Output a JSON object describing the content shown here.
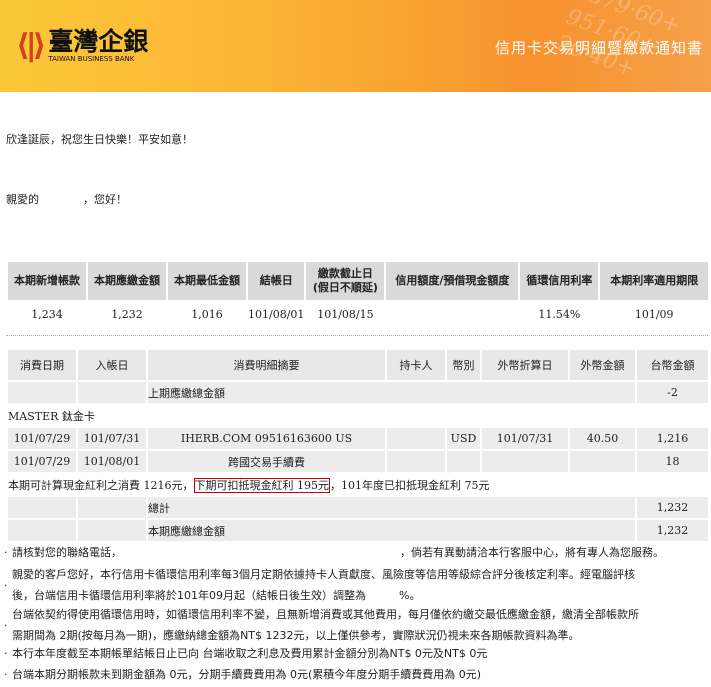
{
  "header": {
    "logo_zh": "臺灣企銀",
    "logo_en": "TAIWAN BUSINESS BANK",
    "title": "信用卡交易明細暨繳款通知書"
  },
  "greeting": "欣逢誕辰，祝您生日快樂！平安如意！",
  "salutation": {
    "prefix": "親愛的",
    "suffix": "，您好！"
  },
  "summary": {
    "headers": [
      "本期新增帳款",
      "本期應繳金額",
      "本期最低金額",
      "結帳日",
      "繳款截止日\n(假日不順延)",
      "信用額度/預借現金額度",
      "循環信用利率",
      "本期利率適用期限"
    ],
    "values": [
      "1,234",
      "1,232",
      "1,016",
      "101/08/01",
      "101/08/15",
      "",
      "11.54%",
      "101/09"
    ]
  },
  "details": {
    "headers": [
      "消費日期",
      "入帳日",
      "消費明細摘要",
      "持卡人",
      "幣別",
      "外幣折算日",
      "外幣金額",
      "台幣金額"
    ],
    "previous": {
      "label": "上期應繳總金額",
      "amount": "-2"
    },
    "card": "MASTER 鈦金卡",
    "rows": [
      [
        "101/07/29",
        "101/07/31",
        "IHERB.COM 09516163600 US",
        "",
        "USD",
        "101/07/31",
        "40.50",
        "1,216"
      ],
      [
        "101/07/29",
        "101/08/01",
        "跨國交易手續費",
        "",
        "",
        "",
        "",
        "18"
      ]
    ],
    "bonus": {
      "before": "本期可計算現金紅利之消費 1216元，",
      "highlight": "下期可扣抵現金紅利 195元",
      "after": "，101年度已扣抵現金紅利 75元"
    },
    "total": {
      "label": "總計",
      "amount": "1,232"
    },
    "due": {
      "label": "本期應繳總金額",
      "amount": "1,232"
    }
  },
  "notes": {
    "n1a": "請核對您的聯絡電話，",
    "n1b": "，倘若有異動請洽本行客服中心，將有專人為您服務。",
    "n2a": "親愛的客戶您好，本行信用卡循環信用利率每3個月定期依據持卡人貢獻度、風險度等信用等級綜合評分後核定利率。經電腦評核",
    "n2b": "後，台端信用卡循環信用利率將於101年09月起（結帳日後生效）調整為　　　%。",
    "n3a": "台端依契約得使用循環信用時，如循環信用利率不變，且無新增消費或其他費用，每月僅依約繳交最低應繳金額，繳清全部帳款所",
    "n3b": "需期間為 2期(按每月為一期)，應繳納總金額為NT$ 1232元，以上僅供參考，實際狀況仍視未來各期帳款資料為準。",
    "n4": "本行本年度截至本期帳單結帳日止已向 台端收取之利息及費用累計金額分別為NT$ 0元及NT$ 0元",
    "n5": "台端本期分期帳款未到期金額為 0元，分期手續費費用為 0元(累積今年度分期手續費費用為 0元)"
  }
}
